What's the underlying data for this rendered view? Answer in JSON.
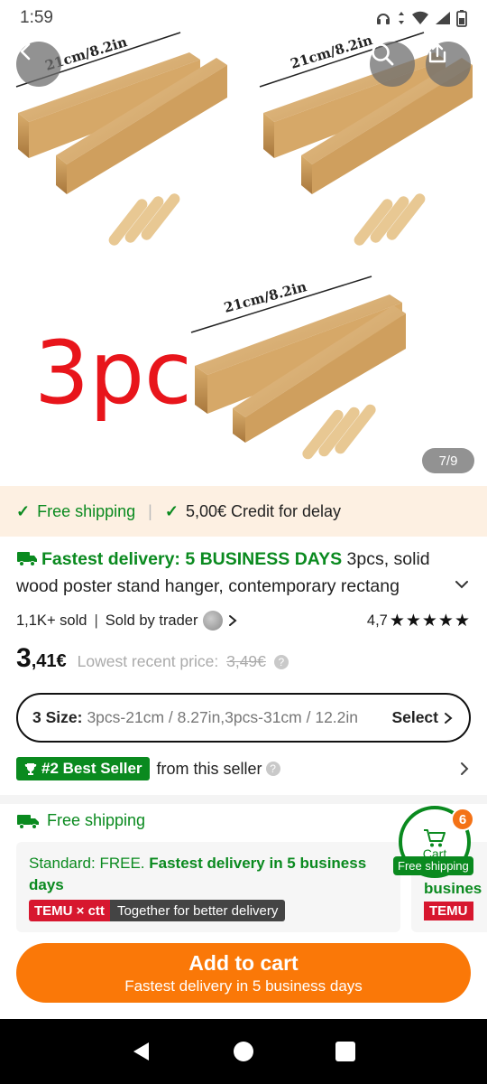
{
  "status_bar": {
    "time": "1:59"
  },
  "hero": {
    "dimension_label": "21cm/8.2in",
    "qty_text": "3pc",
    "page_counter": "7/9"
  },
  "shipping_strip": {
    "free_shipping": "Free shipping",
    "credit": "5,00€ Credit for delay"
  },
  "product": {
    "fastest_delivery": "Fastest delivery: 5 BUSINESS DAYS",
    "title": " 3pcs, solid wood poster stand hanger, contemporary rectang",
    "sold": "1,1K+ sold",
    "sold_by": "Sold by trader",
    "rating": "4,7",
    "stars": "★★★★★"
  },
  "price": {
    "whole": "3",
    "rest": ",41€",
    "note": "Lowest recent price:",
    "old": "3,49€"
  },
  "size_selector": {
    "label": "3 Size:",
    "value": "3pcs-21cm / 8.27in,3pcs-31cm / 12.2in",
    "action": "Select"
  },
  "best_seller": {
    "badge": "#2 Best Seller",
    "from": "from this seller"
  },
  "delivery": {
    "heading": "Free shipping",
    "standard_prefix": "Standard: FREE. ",
    "standard_bold": "Fastest delivery in 5 business days",
    "temu_ctt": "TEMU × ctt",
    "together": "Together for better delivery",
    "card2_text": "busines",
    "card2_tag": "TEMU"
  },
  "cart_fab": {
    "label": "Cart",
    "count": "6",
    "free_shipping": "Free shipping"
  },
  "add_to_cart": {
    "main": "Add to cart",
    "sub": "Fastest delivery in 5 business days"
  },
  "colors": {
    "green": "#0a8a1f",
    "orange": "#fa7808",
    "strip_bg": "#fdf0e2",
    "temu_red": "#d7172f"
  }
}
